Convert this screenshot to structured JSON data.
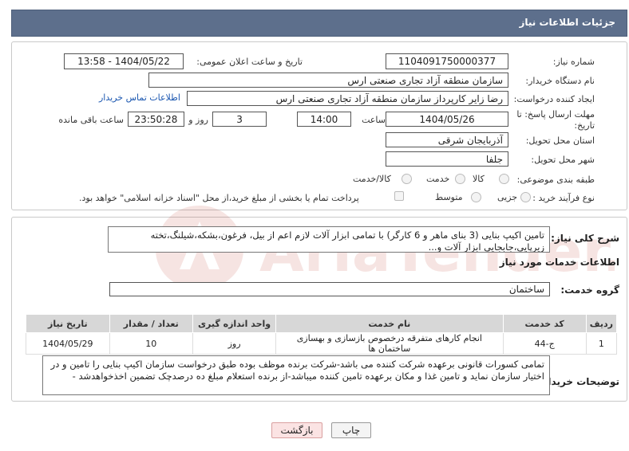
{
  "header": {
    "title": "جزئیات اطلاعات نیاز"
  },
  "form": {
    "need_number_label": "شماره نیاز:",
    "need_number": "1104091750000377",
    "announce_datetime_label": "تاریخ و ساعت اعلان عمومی:",
    "announce_datetime": "1404/05/22 - 13:58",
    "buyer_org_label": "نام دستگاه خریدار:",
    "buyer_org": "سازمان منطقه آزاد تجاری صنعتی ارس",
    "requester_label": "ایجاد کننده درخواست:",
    "requester": "رضا زایر کارپرداز سازمان منطقه آزاد تجاری صنعتی ارس",
    "buyer_contact_link": "اطلاعات تماس خریدار",
    "deadline_label_line1": "مهلت ارسال پاسخ: تا",
    "deadline_label_line2": "تاریخ:",
    "deadline_date": "1404/05/26",
    "time_label": "ساعت",
    "deadline_time": "14:00",
    "days_value": "3",
    "days_label": "روز و",
    "remaining_time": "23:50:28",
    "remaining_label": "ساعت باقی مانده",
    "province_label": "استان محل تحویل:",
    "province": "آذربایجان شرقی",
    "city_label": "شهر محل تحویل:",
    "city": "جلفا",
    "category_label": "طبقه بندی موضوعی:",
    "category_options": [
      "کالا",
      "خدمت",
      "کالا/خدمت"
    ],
    "process_label": "نوع فرآیند خرید :",
    "process_options": [
      "جزیی",
      "متوسط"
    ],
    "payment_note": "پرداخت تمام یا بخشی از مبلغ خرید،از محل \"اسناد خزانه اسلامی\" خواهد بود."
  },
  "description": {
    "label": "شرح کلی نیاز:",
    "text": "تامین اکیپ بنایی (3 بنای ماهر و 6 کارگر) با تمامی ابزار آلات لازم اعم از بیل، فرغون،بشکه،شیلنگ،تخته زیرپایی،جابجایی ابزار آلات و..."
  },
  "services": {
    "title": "اطلاعات خدمات مورد نیاز",
    "group_label": "گروه خدمت:",
    "group_value": "ساختمان",
    "columns": [
      "ردیف",
      "کد خدمت",
      "نام خدمت",
      "واحد اندازه گیری",
      "تعداد / مقدار",
      "تاریخ نیاز"
    ],
    "rows": [
      [
        "1",
        "ج-44",
        "انجام کارهای متفرقه درخصوص بازسازی و بهسازی ساختمان ها",
        "روز",
        "10",
        "1404/05/29"
      ]
    ]
  },
  "buyer_notes": {
    "label": "توضیحات خریدار:",
    "text": "تمامی کسورات قانونی برعهده شرکت کننده می باشد-شرکت برنده موظف بوده طبق درخواست سازمان اکیپ بنایی را تامین و در اختیار سازمان نماید و تامین غذا و مکان برعهده تامین کننده میباشد-از برنده استعلام مبلغ ده درصدچک تضمین اخذخواهدشد -"
  },
  "buttons": {
    "print": "چاپ",
    "back": "بازگشت"
  },
  "watermark": {
    "text": "AriaTender.neT"
  },
  "colors": {
    "header_bg": "#5d6f8c",
    "table_header_bg": "#d7d7d7",
    "link": "#1a56b0",
    "back_button_bg": "#fbe3e3",
    "watermark": "#c0392b"
  }
}
